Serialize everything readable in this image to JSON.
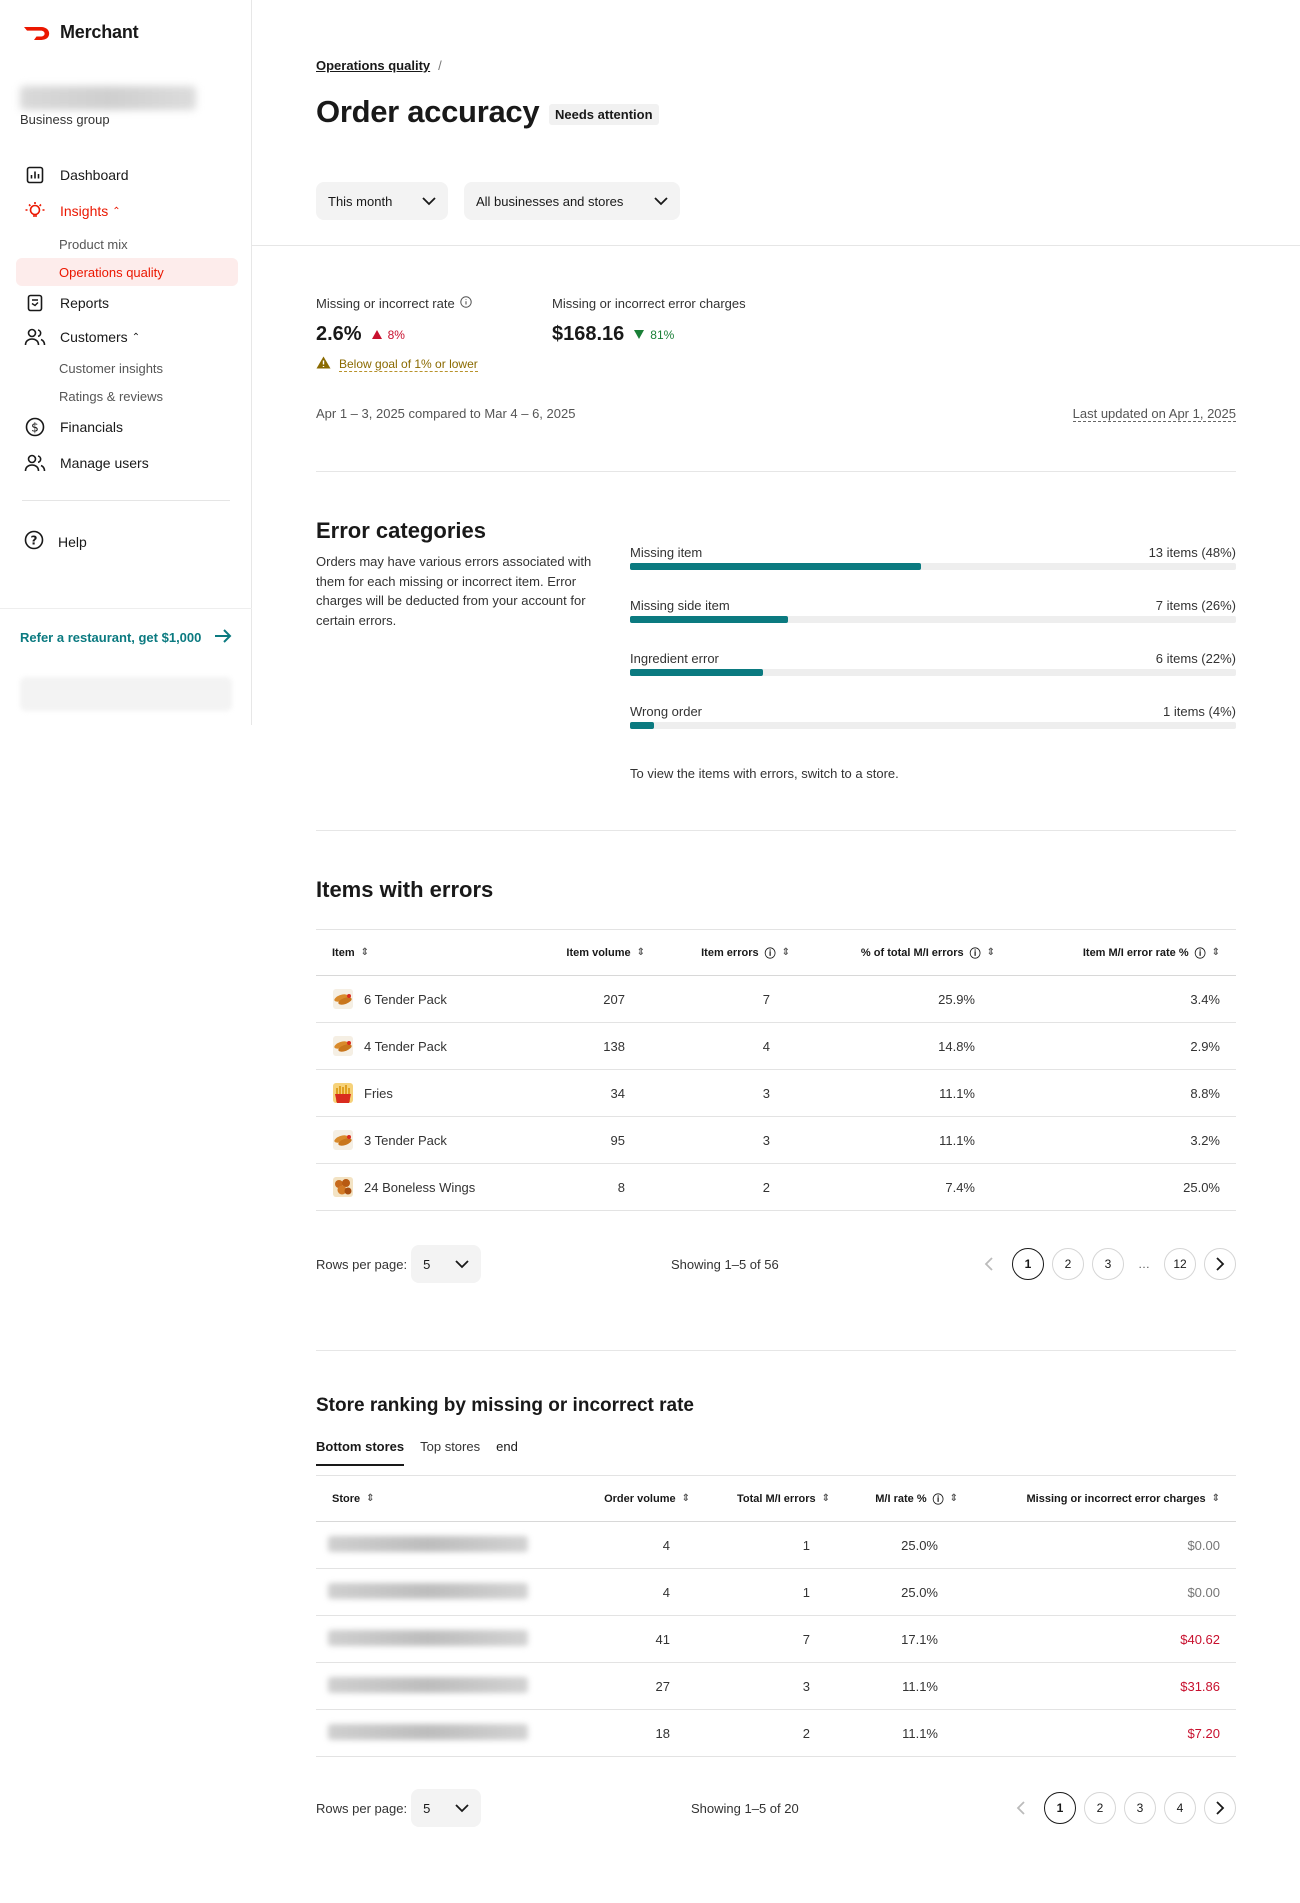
{
  "brand": {
    "name": "Merchant"
  },
  "business": {
    "subtitle": "Business group"
  },
  "nav": {
    "dashboard": "Dashboard",
    "insights": "Insights",
    "product_mix": "Product mix",
    "operations_quality": "Operations quality",
    "reports": "Reports",
    "customers": "Customers",
    "customer_insights": "Customer insights",
    "ratings_reviews": "Ratings & reviews",
    "financials": "Financials",
    "manage_users": "Manage users",
    "help": "Help"
  },
  "refer": {
    "label": "Refer a restaurant, get $1,000"
  },
  "breadcrumb": {
    "parent": "Operations quality",
    "sep": "/"
  },
  "page": {
    "title": "Order accuracy",
    "badge": "Needs attention"
  },
  "filters": {
    "period": "This month",
    "scope": "All businesses and stores"
  },
  "metrics": {
    "rate_label": "Missing or incorrect rate",
    "rate_value": "2.6%",
    "rate_delta": "8%",
    "warning": "Below goal of 1% or lower",
    "charges_label": "Missing or incorrect error charges",
    "charges_value": "$168.16",
    "charges_delta": "81%",
    "compare": "Apr 1 – 3, 2025 compared to Mar 4 – 6, 2025",
    "updated": "Last updated on Apr 1, 2025"
  },
  "categories": {
    "title": "Error categories",
    "description": "Orders may have various errors associated with them for each missing or incorrect item. Error charges will be deducted from your account for certain errors.",
    "footnote": "To view the items with errors, switch to a store.",
    "rows": [
      {
        "label": "Missing item",
        "value": "13 items (48%)",
        "pct": 48
      },
      {
        "label": "Missing side item",
        "value": "7 items (26%)",
        "pct": 26
      },
      {
        "label": "Ingredient error",
        "value": "6 items (22%)",
        "pct": 22
      },
      {
        "label": "Wrong order",
        "value": "1 items (4%)",
        "pct": 4
      }
    ]
  },
  "items_table": {
    "title": "Items with errors",
    "headers": [
      "Item",
      "Item volume",
      "Item errors",
      "% of total M/I errors",
      "Item M/I error rate %"
    ],
    "rows": [
      {
        "name": "6 Tender Pack",
        "volume": "207",
        "errors": "7",
        "share": "25.9%",
        "rate": "3.4%",
        "icon": "tender-pack-thumbnail"
      },
      {
        "name": "4 Tender Pack",
        "volume": "138",
        "errors": "4",
        "share": "14.8%",
        "rate": "2.9%",
        "icon": "tender-pack-thumbnail"
      },
      {
        "name": "Fries",
        "volume": "34",
        "errors": "3",
        "share": "11.1%",
        "rate": "8.8%",
        "icon": "fries-thumbnail"
      },
      {
        "name": "3 Tender Pack",
        "volume": "95",
        "errors": "3",
        "share": "11.1%",
        "rate": "3.2%",
        "icon": "tender-pack-thumbnail"
      },
      {
        "name": "24 Boneless Wings",
        "volume": "8",
        "errors": "2",
        "share": "7.4%",
        "rate": "25.0%",
        "icon": "wings-thumbnail"
      }
    ],
    "rows_label": "Rows per page:",
    "rows_value": "5",
    "showing": "Showing 1–5 of 56",
    "pages": [
      "1",
      "2",
      "3",
      "…",
      "12"
    ]
  },
  "stores_table": {
    "title": "Store ranking by missing or incorrect rate",
    "tabs": [
      "Bottom stores",
      "Top stores"
    ],
    "headers": [
      "Store",
      "Order volume",
      "Total M/I errors",
      "M/I rate %",
      "Missing or incorrect error charges"
    ],
    "rows": [
      {
        "volume": "4",
        "errors": "1",
        "rate": "25.0%",
        "charges": "$0.00",
        "charge_color": "#767676"
      },
      {
        "volume": "4",
        "errors": "1",
        "rate": "25.0%",
        "charges": "$0.00",
        "charge_color": "#767676"
      },
      {
        "volume": "41",
        "errors": "7",
        "rate": "17.1%",
        "charges": "$40.62",
        "charge_color": "#c8102e"
      },
      {
        "volume": "27",
        "errors": "3",
        "rate": "11.1%",
        "charges": "$31.86",
        "charge_color": "#c8102e"
      },
      {
        "volume": "18",
        "errors": "2",
        "rate": "11.1%",
        "charges": "$7.20",
        "charge_color": "#c8102e"
      }
    ],
    "rows_label": "Rows per page:",
    "rows_value": "5",
    "showing": "Showing 1–5 of 20",
    "pages": [
      "1",
      "2",
      "3",
      "4"
    ]
  },
  "colors": {
    "brand": "#eb1700",
    "accent": "#0b7a80",
    "negative": "#c8102e",
    "positive": "#1a7f37"
  }
}
